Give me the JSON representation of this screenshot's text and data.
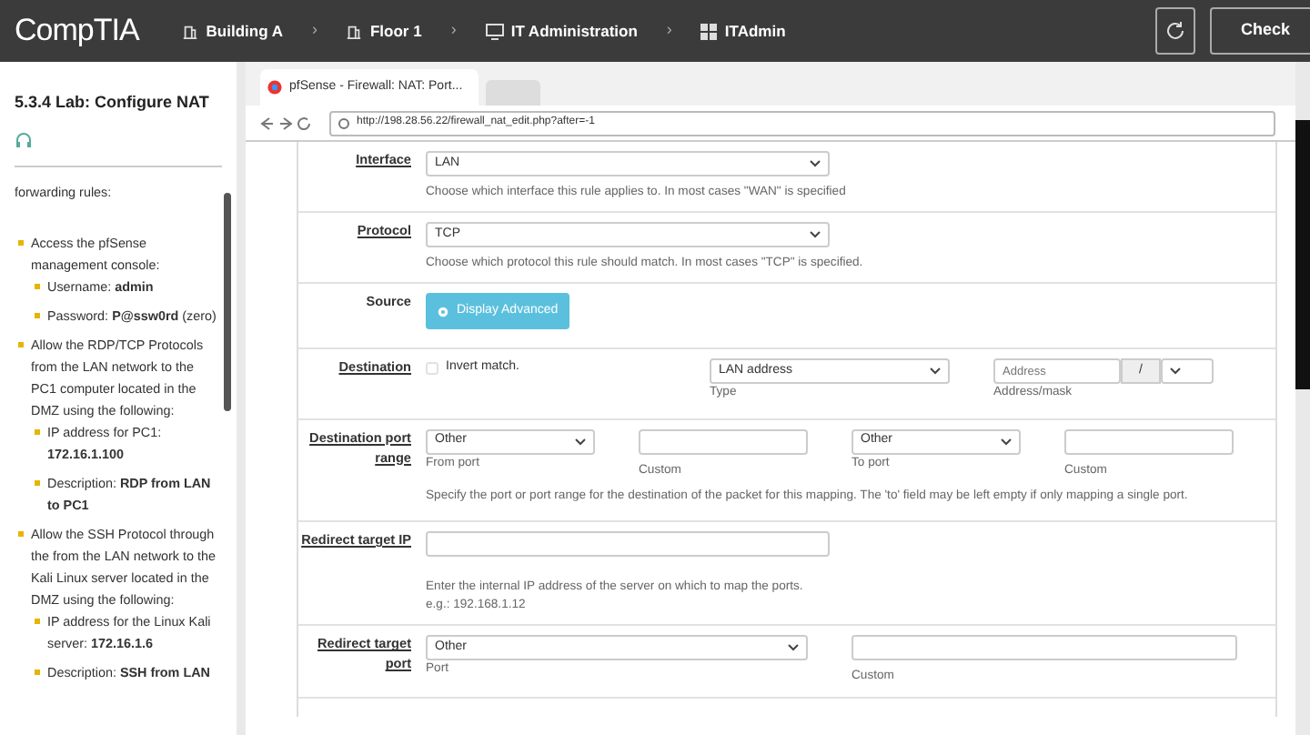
{
  "topbar": {
    "logo": "CompTIA",
    "breadcrumbs": [
      {
        "label": "Building A"
      },
      {
        "label": "Floor 1"
      },
      {
        "label": "IT Administration"
      },
      {
        "label": "ITAdmin"
      }
    ],
    "separator": "›",
    "check_button": "Check"
  },
  "lab": {
    "title": "5.3.4 Lab: Configure NAT",
    "intro": "forwarding rules:",
    "items": [
      {
        "text": "Access the pfSense management console:",
        "children": [
          {
            "text": "Username: **admin**"
          },
          {
            "text": "Password: **P@ssw0rd** (zero)"
          }
        ]
      },
      {
        "text": "Allow the RDP/TCP Protocols from the LAN network to the PC1 computer located in the DMZ using the following:",
        "children": [
          {
            "text": "IP address for PC1: **172.16.1.100**"
          },
          {
            "text": "Description: **RDP from LAN to PC1**"
          }
        ]
      },
      {
        "text": "Allow the SSH Protocol through the from the LAN network to the Kali Linux server located in the DMZ using the following:",
        "children": [
          {
            "text": "IP address for the Linux Kali server: **172.16.1.6**"
          },
          {
            "text": "Description: **SSH from LAN**"
          }
        ]
      }
    ]
  },
  "browser": {
    "tab_title": "pfSense - Firewall: NAT: Port...",
    "url": "http://198.28.56.22/firewall_nat_edit.php?after=-1",
    "rows": [
      {
        "kind": "select",
        "label": "Interface",
        "value": "LAN",
        "help": "Choose which interface this rule applies to. In most cases \"WAN\" is specified"
      },
      {
        "kind": "select",
        "label": "Protocol",
        "value": "TCP",
        "help": "Choose which protocol this rule should match. In most cases \"TCP\" is specified."
      },
      {
        "kind": "button",
        "label": "Source",
        "button": "Display Advanced"
      },
      {
        "kind": "destination",
        "label": "Destination",
        "checkbox_label": "Invert match.",
        "checked": false,
        "type_value": "LAN address",
        "type_caption": "Type",
        "address_placeholder": "Address",
        "mask_separator": "/",
        "address_caption": "Address/mask"
      },
      {
        "kind": "port_range",
        "label": "Destination port range",
        "from_value": "Other",
        "from_caption": "From port",
        "from_custom_caption": "Custom",
        "to_value": "Other",
        "to_caption": "To port",
        "to_custom_caption": "Custom",
        "help": "Specify the port or port range for the destination of the packet for this mapping. The 'to' field may be left empty if only mapping a single port."
      },
      {
        "kind": "text",
        "label": "Redirect target IP",
        "help": "Enter the internal IP address of the server on which to map the ports.",
        "example": "e.g.: 192.168.1.12"
      },
      {
        "kind": "port",
        "label": "Redirect target port",
        "value": "Other",
        "caption": "Port",
        "custom_caption": "Custom"
      }
    ]
  }
}
